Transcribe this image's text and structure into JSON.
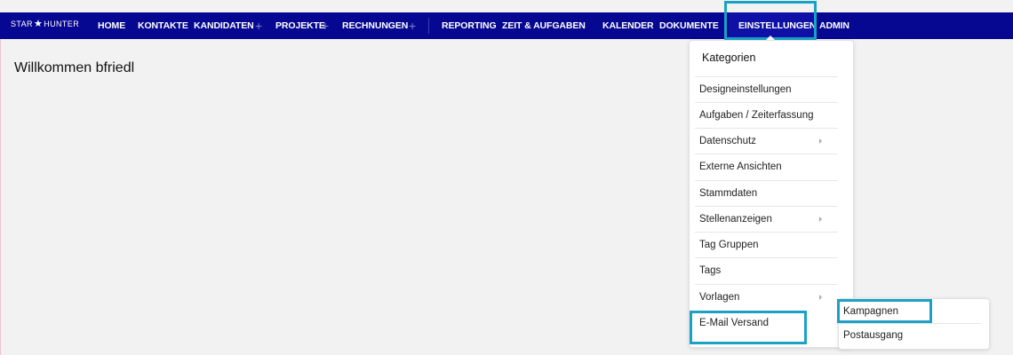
{
  "app": {
    "logo_left": "STAR",
    "logo_star": "★",
    "logo_right": "HUNTER"
  },
  "nav": {
    "items": [
      {
        "label": "HOME"
      },
      {
        "label": "KONTAKTE"
      },
      {
        "label": "KANDIDATEN"
      },
      {
        "label": "PROJEKTE"
      },
      {
        "label": "RECHNUNGEN"
      },
      {
        "label": "REPORTING"
      },
      {
        "label": "ZEIT & AUFGABEN"
      },
      {
        "label": "KALENDER"
      },
      {
        "label": "DOKUMENTE"
      },
      {
        "label": "EINSTELLUNGEN"
      },
      {
        "label": "ADMIN"
      }
    ],
    "plus_glyph": "+"
  },
  "main": {
    "welcome": "Willkommen bfriedl"
  },
  "dropdown": {
    "header": "Kategorien",
    "items": [
      {
        "label": "Designeinstellungen"
      },
      {
        "label": "Aufgaben / Zeiterfassung"
      },
      {
        "label": "Datenschutz"
      },
      {
        "label": "Externe Ansichten"
      },
      {
        "label": "Stammdaten"
      },
      {
        "label": "Stellenanzeigen"
      },
      {
        "label": "Tag Gruppen"
      },
      {
        "label": "Tags"
      },
      {
        "label": "Vorlagen"
      },
      {
        "label": "E-Mail Versand"
      }
    ]
  },
  "submenu": {
    "items": [
      {
        "label": "Kampagnen"
      },
      {
        "label": "Postausgang"
      }
    ]
  },
  "colors": {
    "navbar": "#070891",
    "highlight": "#1ba1c6",
    "background": "#f2f2f2"
  }
}
